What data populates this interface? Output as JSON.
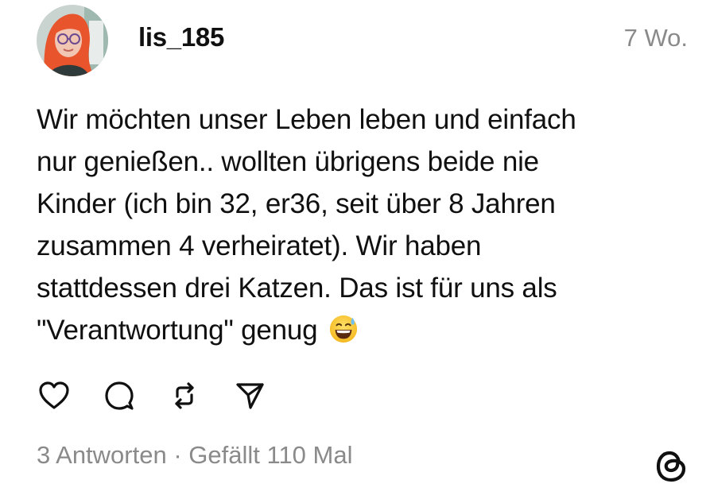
{
  "post": {
    "username": "lis_185",
    "timestamp": "7 Wo.",
    "text_lines": [
      "Wir möchten unser Leben leben und einfach",
      "nur genießen.. wollten übrigens beide nie",
      "Kinder (ich bin 32, er36, seit über 8 Jahren",
      "zusammen 4 verheiratet). Wir haben",
      "stattdessen drei Katzen. Das ist für uns als",
      "\"Verantwortung\" genug"
    ],
    "emoji": "grinning-face-with-sweat-icon",
    "replies": "3 Antworten",
    "separator": "·",
    "likes": "Gefällt 110 Mal"
  },
  "actions": [
    {
      "icon": "heart-icon"
    },
    {
      "icon": "comment-icon"
    },
    {
      "icon": "repost-icon"
    },
    {
      "icon": "share-icon"
    }
  ],
  "logo": "threads-logo-icon",
  "colors": {
    "text": "#101010",
    "muted": "#8a8a8a",
    "background": "#ffffff"
  }
}
